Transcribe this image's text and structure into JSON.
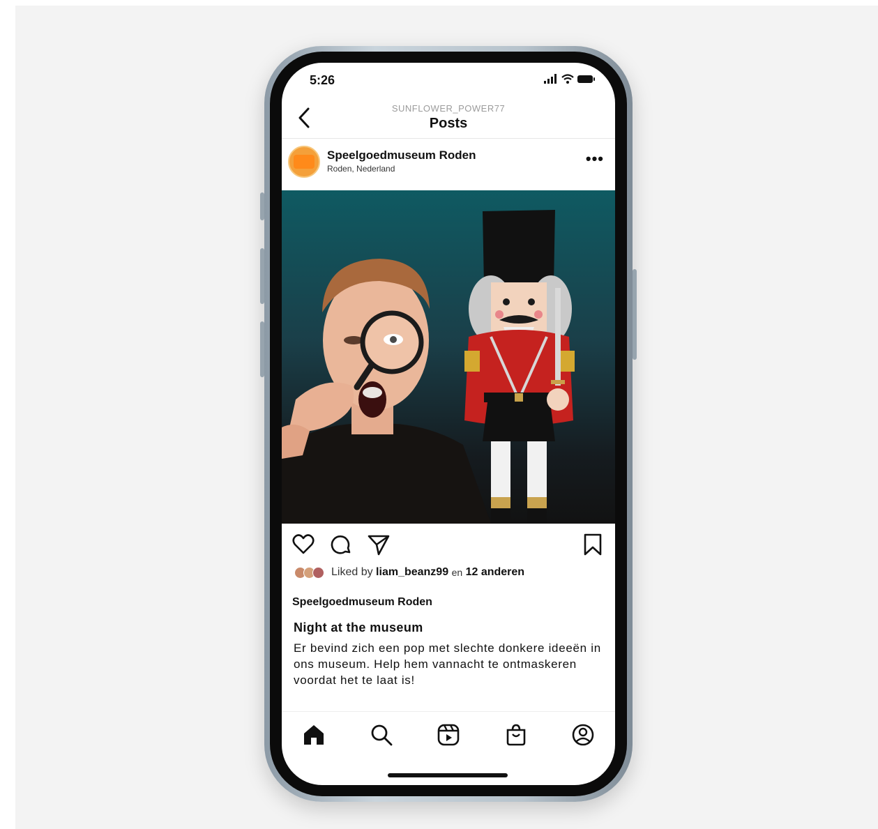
{
  "status_bar": {
    "time": "5:26"
  },
  "header": {
    "username": "SUNFLOWER_POWER77",
    "title": "Posts"
  },
  "post": {
    "account_name": "Speelgoedmuseum Roden",
    "location": "Roden, Nederland",
    "likes": {
      "prefix": "Liked by",
      "user": "liam_beanz99",
      "connector": "en",
      "others": "12 anderen"
    },
    "caption_account": "Speelgoedmuseum Roden",
    "caption_title": "Night at the museum",
    "caption_body": "Er bevind zich een pop met slechte donkere ideeën in ons museum. Help hem vannacht te ontmaskeren voordat het te laat is!"
  },
  "icons": {
    "actions": [
      "heart-icon",
      "comment-icon",
      "share-icon",
      "bookmark-icon"
    ],
    "tabs": [
      "home-icon",
      "search-icon",
      "reels-icon",
      "shop-icon",
      "profile-icon"
    ]
  },
  "colors": {
    "image_top": "#0f5a62",
    "image_bottom": "#121212",
    "nutcracker_red": "#c5221f",
    "avatar_orange": "#f4a03a"
  }
}
